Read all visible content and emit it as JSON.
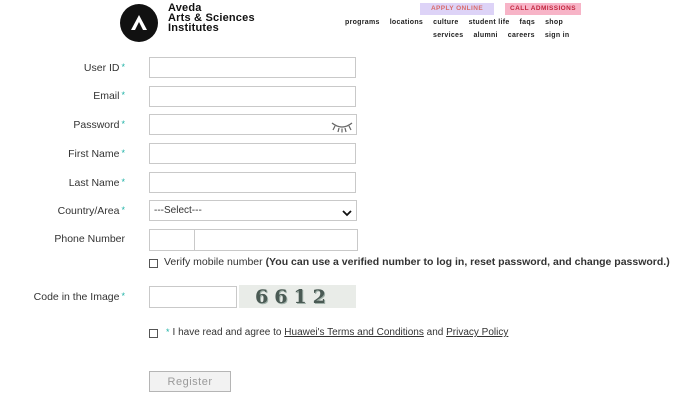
{
  "header": {
    "brand_line1": "Aveda",
    "brand_line2": "Arts & Sciences",
    "brand_line3": "Institutes",
    "apply_label": "apply online",
    "call_label": "call admissions",
    "nav_row1": [
      "programs",
      "locations",
      "culture",
      "student life",
      "faqs",
      "shop"
    ],
    "nav_row2": [
      "services",
      "alumni",
      "careers",
      "sign in"
    ]
  },
  "form": {
    "required_mark": "*",
    "user_id_label": "User ID",
    "email_label": "Email",
    "password_label": "Password",
    "first_name_label": "First Name",
    "last_name_label": "Last Name",
    "country_label": "Country/Area",
    "country_selected": "---Select---",
    "phone_label": "Phone Number",
    "verify_label": "Verify mobile number",
    "verify_note": "(You can use a verified number to log in, reset password, and change password.)",
    "captcha_label": "Code in the Image",
    "captcha_code": "6612",
    "agree_prefix": "I have read and agree to",
    "terms_link": "Huawei's Terms and Conditions",
    "agree_and": "and",
    "privacy_link": "Privacy Policy",
    "register_label": "Register"
  },
  "colors": {
    "required_star": "#1eb2a6",
    "apply_bg": "#ddd3f7",
    "call_bg": "#f7b4c7"
  }
}
